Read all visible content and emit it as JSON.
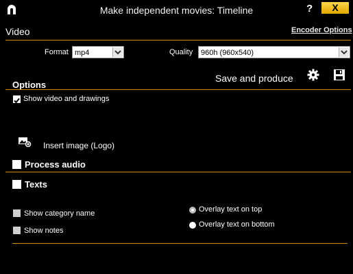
{
  "window": {
    "title": "Make independent movies: Timeline",
    "help_label": "?",
    "close_label": "X"
  },
  "video": {
    "section_title": "Video",
    "encoder_link": "Encoder Options",
    "format_label": "Format",
    "format_value": "mp4",
    "quality_label": "Quality",
    "quality_value": "960h (960x540)",
    "save_label": "Save and produce"
  },
  "options": {
    "section_title": "Options",
    "show_video_drawings": "Show video and drawings",
    "insert_image": "Insert image (Logo)",
    "process_audio": "Process audio"
  },
  "texts": {
    "section_title": "Texts",
    "show_category": "Show category name",
    "show_notes": "Show notes",
    "overlay_top": "Overlay text on top",
    "overlay_bottom": "Overlay text on bottom"
  },
  "colors": {
    "accent": "#d08a14",
    "close_button": "#f0c020"
  }
}
